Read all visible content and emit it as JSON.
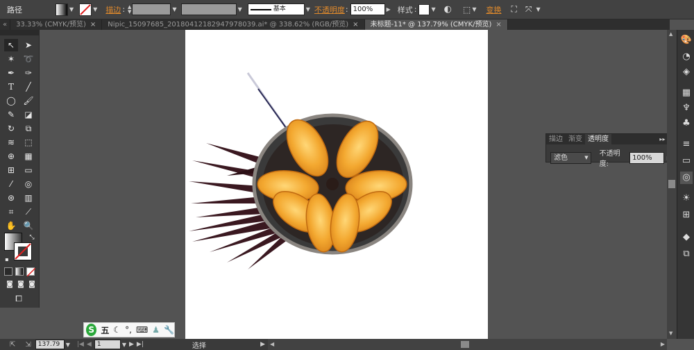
{
  "control_bar": {
    "path_label": "路径",
    "stroke_label": "描边",
    "stroke_colon": ":",
    "stroke_profile": "基本",
    "opacity_label": "不透明度",
    "opacity_colon": ":",
    "opacity_value": "100%",
    "style_label": "样式",
    "style_colon": ":",
    "transform_label": "变换"
  },
  "tabs": [
    {
      "label": "33.33% (CMYK/预览)",
      "active": false
    },
    {
      "label": "Nipic_15097685_20180412182947978039.ai* @ 338.62% (RGB/预览)",
      "active": false
    },
    {
      "label": "未标题-11* @ 137.79% (CMYK/预览)",
      "active": true
    }
  ],
  "tab_scroll_glyph": "«",
  "transparency_panel": {
    "tabs": [
      "描边",
      "渐变",
      "透明度"
    ],
    "active_tab": "透明度",
    "blend_mode": "滤色",
    "opacity_label": "不透明度:",
    "opacity_value": "100%"
  },
  "status_bar": {
    "zoom": "137.79",
    "artboard": "1",
    "tool_name": "选择"
  },
  "ime_bar": {
    "logo": "S",
    "mode": "五"
  },
  "colors": {
    "accent_orange": "#e08a2c",
    "canvas": "#535353",
    "artboard": "#ffffff",
    "urchin_orange": "#f0a52a",
    "spine_dark": "#3a1820"
  }
}
